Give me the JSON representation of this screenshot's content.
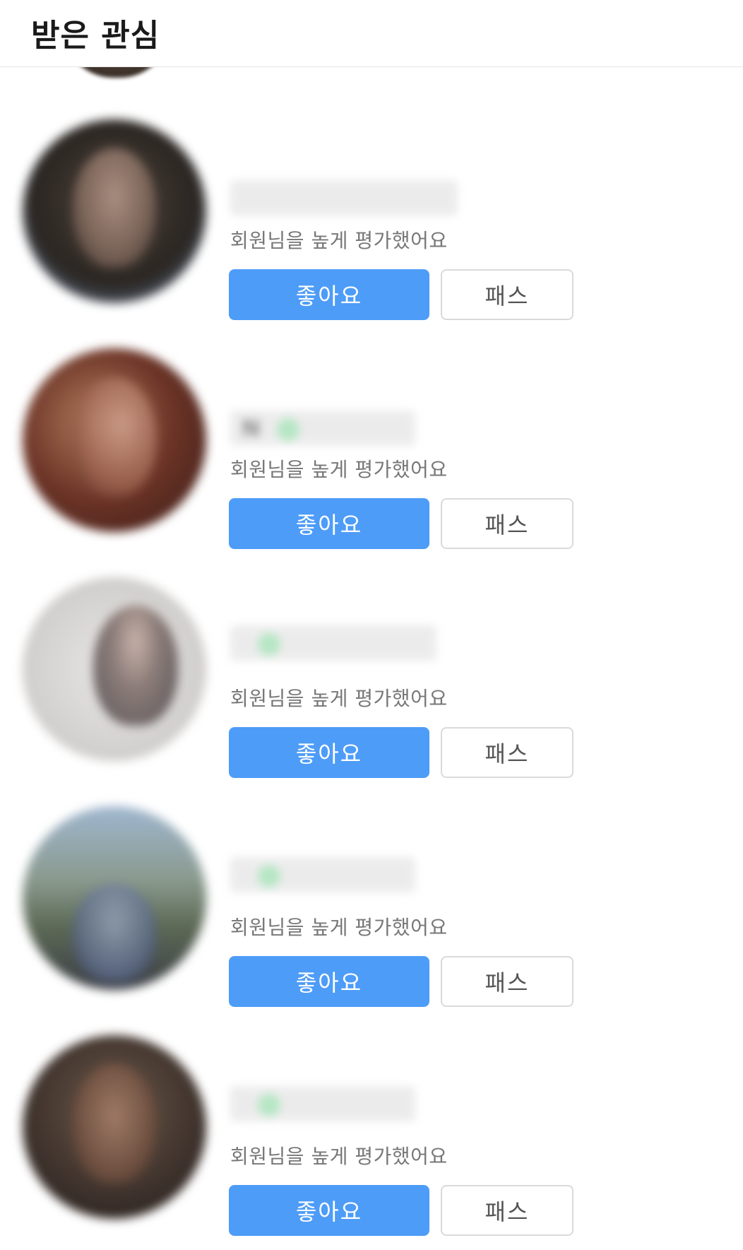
{
  "header": {
    "title": "받은 관심"
  },
  "items": [
    {
      "subtitle": "회원님을 높게 평가했어요",
      "like_label": "좋아요",
      "pass_label": "패스",
      "name_prefix": ""
    },
    {
      "subtitle": "회원님을 높게 평가했어요",
      "like_label": "좋아요",
      "pass_label": "패스",
      "name_prefix": "N"
    },
    {
      "subtitle": "회원님을 높게 평가했어요",
      "like_label": "좋아요",
      "pass_label": "패스",
      "name_prefix": ""
    },
    {
      "subtitle": "회원님을 높게 평가했어요",
      "like_label": "좋아요",
      "pass_label": "패스",
      "name_prefix": ""
    },
    {
      "subtitle": "회원님을 높게 평가했어요",
      "like_label": "좋아요",
      "pass_label": "패스",
      "name_prefix": ""
    }
  ],
  "colors": {
    "accent": "#4d9cf8",
    "online_dot": "#6fd08b",
    "subtitle_text": "#777777",
    "pass_border": "#dadada"
  }
}
